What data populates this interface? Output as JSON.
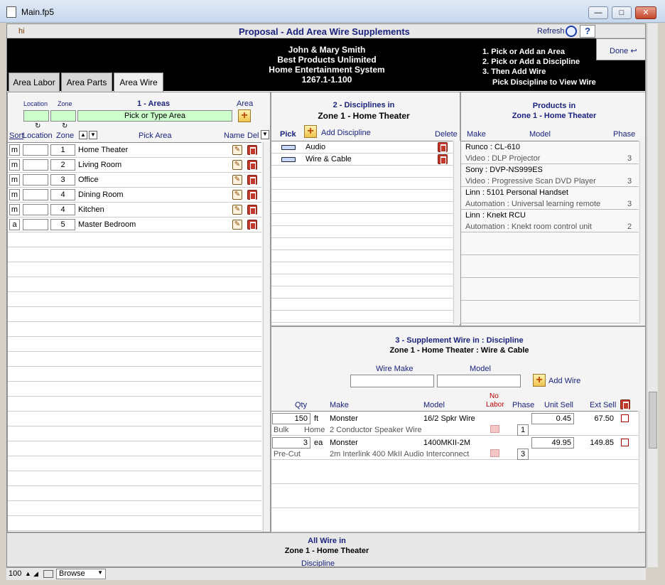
{
  "window": {
    "title": "Main.fp5"
  },
  "topbar": {
    "user": "hi",
    "title": "Proposal - Add Area Wire Supplements",
    "refresh_label": "Refresh",
    "help_label": "?",
    "done_label": "Done"
  },
  "client_info": {
    "name": "John & Mary Smith",
    "company": "Best Products Unlimited",
    "project": "Home Entertainment System",
    "number": "1267.1-1.100"
  },
  "instructions": [
    "1. Pick or Add an Area",
    "2. Pick or Add a Discipline",
    "3. Then Add Wire",
    "Pick Discipline to View Wire"
  ],
  "tabs": [
    "Area Labor",
    "Area Parts",
    "Area Wire"
  ],
  "areas": {
    "header": "1 - Areas",
    "location_label": "Location",
    "zone_label": "Zone",
    "area_label": "Area",
    "pick_placeholder": "Pick or Type Area",
    "cols": {
      "sort": "Sort",
      "location": "Location",
      "zone": "Zone",
      "pick": "Pick Area",
      "name": "Name",
      "del": "Del"
    },
    "rows": [
      {
        "sort": "m",
        "location": "",
        "zone": "1",
        "name": "Home Theater"
      },
      {
        "sort": "m",
        "location": "",
        "zone": "2",
        "name": "Living Room"
      },
      {
        "sort": "m",
        "location": "",
        "zone": "3",
        "name": "Office"
      },
      {
        "sort": "m",
        "location": "",
        "zone": "4",
        "name": "Dining Room"
      },
      {
        "sort": "m",
        "location": "",
        "zone": "4",
        "name": "Kitchen"
      },
      {
        "sort": "a",
        "location": "",
        "zone": "5",
        "name": "Master Bedroom"
      }
    ]
  },
  "disciplines": {
    "header1": "2 - Disciplines in",
    "header2": "Zone 1 - Home Theater",
    "pick_label": "Pick",
    "add_label": "Add Discipline",
    "delete_label": "Delete",
    "rows": [
      "Audio",
      "Wire & Cable"
    ]
  },
  "products": {
    "header1": "Products in",
    "header2": "Zone 1 - Home Theater",
    "cols": {
      "make": "Make",
      "model": "Model",
      "phase": "Phase"
    },
    "rows": [
      {
        "title": "Runco : CL-610",
        "sub": "Video : DLP Projector",
        "phase": "3"
      },
      {
        "title": "Sony : DVP-NS999ES",
        "sub": "Video : Progressive Scan DVD Player",
        "phase": "3"
      },
      {
        "title": "Linn : 5101 Personal Handset",
        "sub": "Automation : Universal learning remote",
        "phase": "3"
      },
      {
        "title": "Linn : Knekt RCU",
        "sub": "Automation : Knekt room control unit",
        "phase": "2"
      }
    ]
  },
  "wire": {
    "header1": "3 - Supplement Wire in : Discipline",
    "header2": "Zone 1 - Home Theater : Wire & Cable",
    "make_label": "Wire Make",
    "model_label": "Model",
    "add_label": "Add  Wire",
    "cols": {
      "qty": "Qty",
      "make": "Make",
      "model": "Model",
      "nolabor1": "No",
      "nolabor2": "Labor",
      "phase": "Phase",
      "unit": "Unit Sell",
      "ext": "Ext Sell"
    },
    "rows": [
      {
        "qty": "150",
        "unit_type": "ft",
        "make": "Monster",
        "model": "16/2 Spkr Wire",
        "unit_sell": "0.45",
        "ext_sell": "67.50",
        "tag1": "Bulk",
        "tag2": "Home",
        "desc": "2 Conductor Speaker Wire",
        "phase": "1"
      },
      {
        "qty": "3",
        "unit_type": "ea",
        "make": "Monster",
        "model": "1400MKII-2M",
        "unit_sell": "49.95",
        "ext_sell": "149.85",
        "tag1": "Pre-Cut",
        "tag2": "",
        "desc": "2m Interlink 400 MkII Audio Interconnect",
        "phase": "3"
      }
    ]
  },
  "allwire": {
    "header1": "All Wire in",
    "header2": "Zone 1 - Home Theater",
    "col": "Discipline"
  },
  "status": {
    "zoom": "100",
    "mode": "Browse"
  },
  "colors": {
    "accent": "#1a237e",
    "pick_field": "#ccffcc",
    "delete": "#c0392b"
  }
}
